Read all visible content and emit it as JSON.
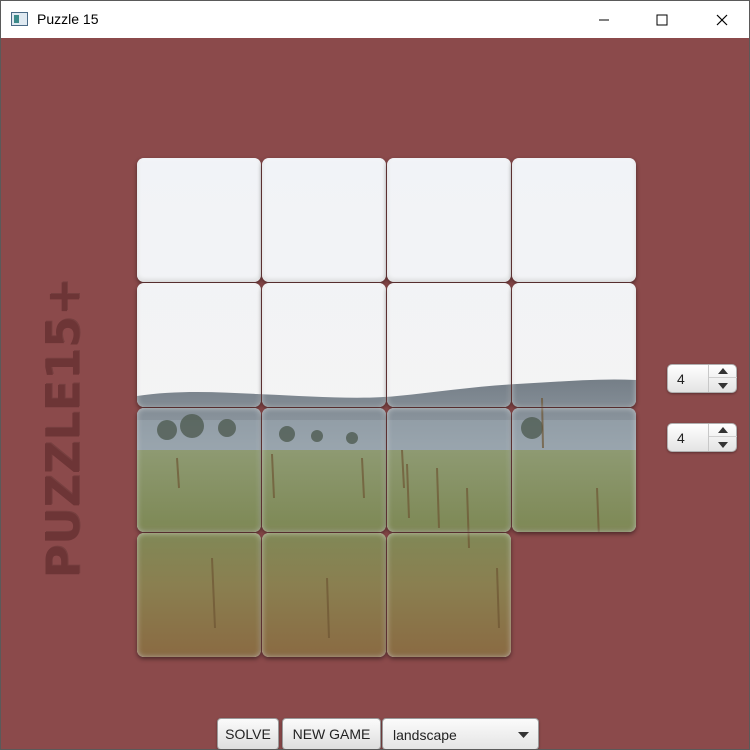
{
  "window": {
    "title": "Puzzle 15"
  },
  "logo": {
    "text": "PUZZLE15+"
  },
  "board": {
    "rows": 4,
    "cols": 4,
    "image": "landscape",
    "tiles": [
      {
        "row": 0,
        "col": 0,
        "empty": false
      },
      {
        "row": 0,
        "col": 1,
        "empty": false
      },
      {
        "row": 0,
        "col": 2,
        "empty": false
      },
      {
        "row": 0,
        "col": 3,
        "empty": false
      },
      {
        "row": 1,
        "col": 0,
        "empty": false
      },
      {
        "row": 1,
        "col": 1,
        "empty": false
      },
      {
        "row": 1,
        "col": 2,
        "empty": false
      },
      {
        "row": 1,
        "col": 3,
        "empty": false
      },
      {
        "row": 2,
        "col": 0,
        "empty": false
      },
      {
        "row": 2,
        "col": 1,
        "empty": false
      },
      {
        "row": 2,
        "col": 2,
        "empty": false
      },
      {
        "row": 2,
        "col": 3,
        "empty": false
      },
      {
        "row": 3,
        "col": 0,
        "empty": false
      },
      {
        "row": 3,
        "col": 1,
        "empty": false
      },
      {
        "row": 3,
        "col": 2,
        "empty": false
      },
      {
        "row": 3,
        "col": 3,
        "empty": true
      }
    ]
  },
  "controls": {
    "rows_value": "4",
    "cols_value": "4",
    "solve_label": "SOLVE",
    "new_game_label": "NEW GAME",
    "image_selected": "landscape"
  },
  "colors": {
    "background": "#8b4a4b",
    "logo": "#6d3536"
  }
}
